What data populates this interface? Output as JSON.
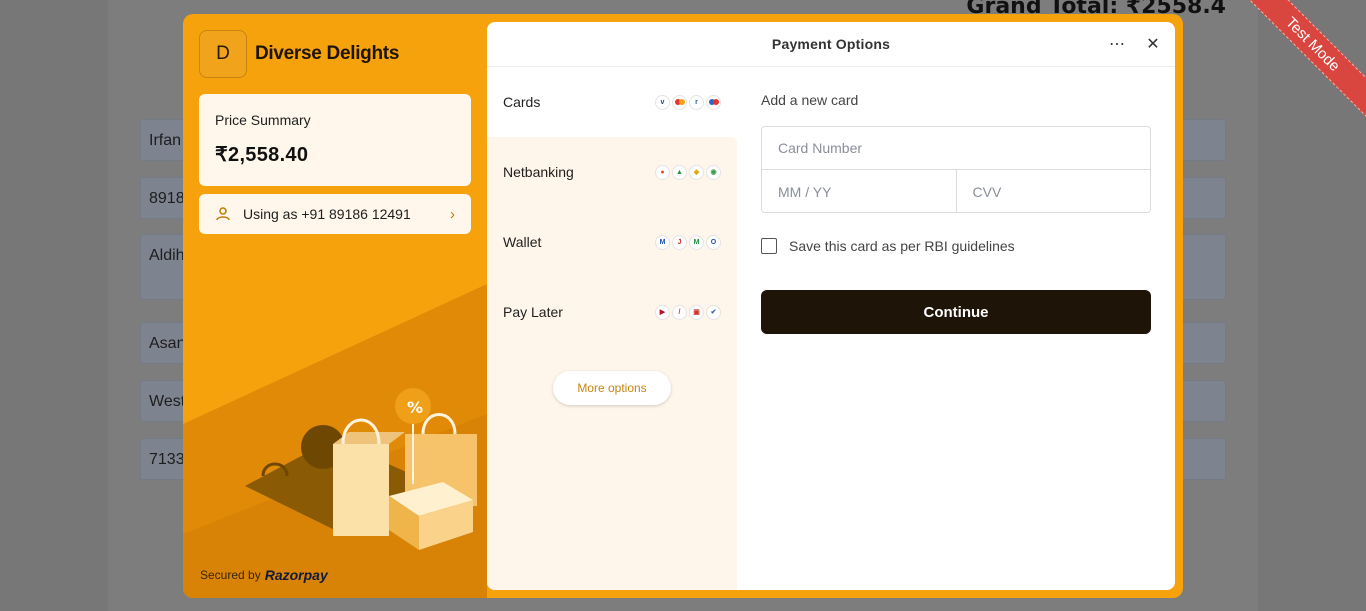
{
  "background": {
    "grand_total": "Grand Total: ₹2558.4",
    "fields": [
      "Irfan",
      "8918",
      "Aldih",
      "Asan",
      "West",
      "7133"
    ]
  },
  "ribbon": {
    "label": "Test Mode"
  },
  "merchant": {
    "logo_letter": "D",
    "name": "Diverse Delights"
  },
  "price_summary": {
    "label": "Price Summary",
    "amount": "₹2,558.40"
  },
  "user": {
    "label": "Using as +91 89186 12491"
  },
  "footer": {
    "secured_by": "Secured by",
    "brand": "Razorpay"
  },
  "header": {
    "title": "Payment Options"
  },
  "methods": [
    {
      "label": "Cards",
      "icons": [
        "visa-icon",
        "mastercard-icon",
        "rupay-icon",
        "maestro-icon"
      ]
    },
    {
      "label": "Netbanking",
      "icons": [
        "bank-icon-1",
        "bank-icon-2",
        "bank-icon-3",
        "bank-icon-4"
      ]
    },
    {
      "label": "Wallet",
      "icons": [
        "wallet-icon-1",
        "wallet-icon-2",
        "wallet-icon-3",
        "wallet-icon-4"
      ]
    },
    {
      "label": "Pay Later",
      "icons": [
        "paylater-icon-1",
        "paylater-icon-2",
        "paylater-icon-3",
        "paylater-icon-4"
      ]
    }
  ],
  "more_options": {
    "label": "More options"
  },
  "card_form": {
    "title": "Add a new card",
    "card_number_placeholder": "Card Number",
    "expiry_placeholder": "MM / YY",
    "cvv_placeholder": "CVV",
    "save_label": "Save this card as per RBI guidelines",
    "continue_label": "Continue"
  },
  "colors": {
    "accent": "#f5a20d",
    "panel": "#fff7ec",
    "button": "#1e1408",
    "ribbon": "#d9453f"
  }
}
